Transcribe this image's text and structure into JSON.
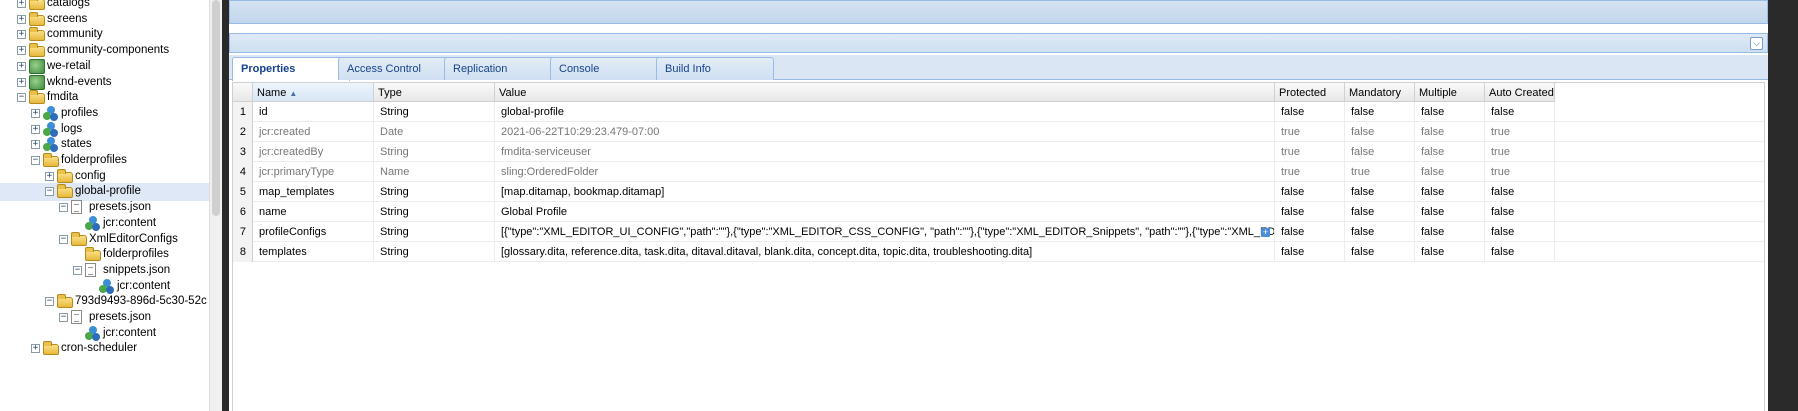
{
  "tree": {
    "items": [
      {
        "label": "catalogs",
        "icon": "folder-icon",
        "state": "plus"
      },
      {
        "label": "screens",
        "icon": "folder-icon",
        "state": "plus"
      },
      {
        "label": "community",
        "icon": "folder-icon",
        "state": "plus"
      },
      {
        "label": "community-components",
        "icon": "folder-icon",
        "state": "plus"
      },
      {
        "label": "we-retail",
        "icon": "globe-icon",
        "state": "plus"
      },
      {
        "label": "wknd-events",
        "icon": "globe-icon",
        "state": "plus"
      },
      {
        "label": "fmdita",
        "icon": "folder-icon",
        "state": "minus"
      },
      {
        "label": "profiles",
        "icon": "node-icon",
        "state": "plus"
      },
      {
        "label": "logs",
        "icon": "node-icon",
        "state": "plus"
      },
      {
        "label": "states",
        "icon": "node-icon",
        "state": "plus"
      },
      {
        "label": "folderprofiles",
        "icon": "folder-icon",
        "state": "minus"
      },
      {
        "label": "config",
        "icon": "folder-icon",
        "state": "plus"
      },
      {
        "label": "global-profile",
        "icon": "folder-icon",
        "state": "minus",
        "selected": true
      },
      {
        "label": "presets.json",
        "icon": "file-icon",
        "state": "minus"
      },
      {
        "label": "jcr:content",
        "icon": "node-icon",
        "state": "none"
      },
      {
        "label": "XmlEditorConfigs",
        "icon": "folder-icon",
        "state": "minus"
      },
      {
        "label": "folderprofiles",
        "icon": "folder-icon",
        "state": "none"
      },
      {
        "label": "snippets.json",
        "icon": "file-icon",
        "state": "minus"
      },
      {
        "label": "jcr:content",
        "icon": "node-icon",
        "state": "none"
      },
      {
        "label": "793d9493-896d-5c30-52c",
        "icon": "folder-icon",
        "state": "minus"
      },
      {
        "label": "presets.json",
        "icon": "file-icon",
        "state": "minus"
      },
      {
        "label": "jcr:content",
        "icon": "node-icon",
        "state": "none"
      },
      {
        "label": "cron-scheduler",
        "icon": "folder-icon",
        "state": "plus"
      }
    ]
  },
  "tabs": [
    {
      "label": "Properties",
      "active": true
    },
    {
      "label": "Access Control"
    },
    {
      "label": "Replication"
    },
    {
      "label": "Console"
    },
    {
      "label": "Build Info"
    }
  ],
  "grid": {
    "columns": [
      "",
      "Name",
      "Type",
      "Value",
      "Protected",
      "Mandatory",
      "Multiple",
      "Auto Created"
    ],
    "sorted_column": "Name",
    "rows": [
      {
        "num": "1",
        "name": "id",
        "type": "String",
        "value": "global-profile",
        "protected": "false",
        "mandatory": "false",
        "multiple": "false",
        "auto": "false",
        "dim": false
      },
      {
        "num": "2",
        "name": "jcr:created",
        "type": "Date",
        "value": "2021-06-22T10:29:23.479-07:00",
        "protected": "true",
        "mandatory": "false",
        "multiple": "false",
        "auto": "true",
        "dim": true
      },
      {
        "num": "3",
        "name": "jcr:createdBy",
        "type": "String",
        "value": "fmdita-serviceuser",
        "protected": "true",
        "mandatory": "false",
        "multiple": "false",
        "auto": "true",
        "dim": true
      },
      {
        "num": "4",
        "name": "jcr:primaryType",
        "type": "Name",
        "value": "sling:OrderedFolder",
        "protected": "true",
        "mandatory": "true",
        "multiple": "false",
        "auto": "true",
        "dim": true
      },
      {
        "num": "5",
        "name": "map_templates",
        "type": "String",
        "value": "[map.ditamap, bookmap.ditamap]",
        "protected": "false",
        "mandatory": "false",
        "multiple": "false",
        "auto": "false",
        "dim": false
      },
      {
        "num": "6",
        "name": "name",
        "type": "String",
        "value": "Global Profile",
        "protected": "false",
        "mandatory": "false",
        "multiple": "false",
        "auto": "false",
        "dim": false
      },
      {
        "num": "7",
        "name": "profileConfigs",
        "type": "String",
        "value": "[{\"type\":\"XML_EDITOR_UI_CONFIG\",\"path\":\"\"},{\"type\":\"XML_EDITOR_CSS_CONFIG\", \"path\":\"\"},{\"type\":\"XML_EDITOR_Snippets\", \"path\":\"\"},{\"type\":\"XML_EDITOR_ROOT_MA...",
        "protected": "false",
        "mandatory": "false",
        "multiple": "false",
        "auto": "false",
        "dim": false,
        "expandable": true
      },
      {
        "num": "8",
        "name": "templates",
        "type": "String",
        "value": "[glossary.dita, reference.dita, task.dita, ditaval.ditaval, blank.dita, concept.dita, topic.dita, troubleshooting.dita]",
        "protected": "false",
        "mandatory": "false",
        "multiple": "false",
        "auto": "false",
        "dim": false
      }
    ]
  }
}
